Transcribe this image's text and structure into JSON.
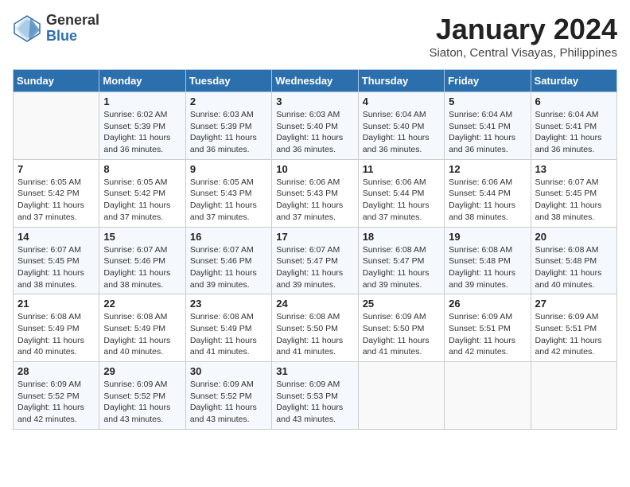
{
  "logo": {
    "general": "General",
    "blue": "Blue"
  },
  "title": "January 2024",
  "location": "Siaton, Central Visayas, Philippines",
  "days_header": [
    "Sunday",
    "Monday",
    "Tuesday",
    "Wednesday",
    "Thursday",
    "Friday",
    "Saturday"
  ],
  "weeks": [
    [
      {
        "day": "",
        "info": ""
      },
      {
        "day": "1",
        "info": "Sunrise: 6:02 AM\nSunset: 5:39 PM\nDaylight: 11 hours\nand 36 minutes."
      },
      {
        "day": "2",
        "info": "Sunrise: 6:03 AM\nSunset: 5:39 PM\nDaylight: 11 hours\nand 36 minutes."
      },
      {
        "day": "3",
        "info": "Sunrise: 6:03 AM\nSunset: 5:40 PM\nDaylight: 11 hours\nand 36 minutes."
      },
      {
        "day": "4",
        "info": "Sunrise: 6:04 AM\nSunset: 5:40 PM\nDaylight: 11 hours\nand 36 minutes."
      },
      {
        "day": "5",
        "info": "Sunrise: 6:04 AM\nSunset: 5:41 PM\nDaylight: 11 hours\nand 36 minutes."
      },
      {
        "day": "6",
        "info": "Sunrise: 6:04 AM\nSunset: 5:41 PM\nDaylight: 11 hours\nand 36 minutes."
      }
    ],
    [
      {
        "day": "7",
        "info": "Sunrise: 6:05 AM\nSunset: 5:42 PM\nDaylight: 11 hours\nand 37 minutes."
      },
      {
        "day": "8",
        "info": "Sunrise: 6:05 AM\nSunset: 5:42 PM\nDaylight: 11 hours\nand 37 minutes."
      },
      {
        "day": "9",
        "info": "Sunrise: 6:05 AM\nSunset: 5:43 PM\nDaylight: 11 hours\nand 37 minutes."
      },
      {
        "day": "10",
        "info": "Sunrise: 6:06 AM\nSunset: 5:43 PM\nDaylight: 11 hours\nand 37 minutes."
      },
      {
        "day": "11",
        "info": "Sunrise: 6:06 AM\nSunset: 5:44 PM\nDaylight: 11 hours\nand 37 minutes."
      },
      {
        "day": "12",
        "info": "Sunrise: 6:06 AM\nSunset: 5:44 PM\nDaylight: 11 hours\nand 38 minutes."
      },
      {
        "day": "13",
        "info": "Sunrise: 6:07 AM\nSunset: 5:45 PM\nDaylight: 11 hours\nand 38 minutes."
      }
    ],
    [
      {
        "day": "14",
        "info": "Sunrise: 6:07 AM\nSunset: 5:45 PM\nDaylight: 11 hours\nand 38 minutes."
      },
      {
        "day": "15",
        "info": "Sunrise: 6:07 AM\nSunset: 5:46 PM\nDaylight: 11 hours\nand 38 minutes."
      },
      {
        "day": "16",
        "info": "Sunrise: 6:07 AM\nSunset: 5:46 PM\nDaylight: 11 hours\nand 39 minutes."
      },
      {
        "day": "17",
        "info": "Sunrise: 6:07 AM\nSunset: 5:47 PM\nDaylight: 11 hours\nand 39 minutes."
      },
      {
        "day": "18",
        "info": "Sunrise: 6:08 AM\nSunset: 5:47 PM\nDaylight: 11 hours\nand 39 minutes."
      },
      {
        "day": "19",
        "info": "Sunrise: 6:08 AM\nSunset: 5:48 PM\nDaylight: 11 hours\nand 39 minutes."
      },
      {
        "day": "20",
        "info": "Sunrise: 6:08 AM\nSunset: 5:48 PM\nDaylight: 11 hours\nand 40 minutes."
      }
    ],
    [
      {
        "day": "21",
        "info": "Sunrise: 6:08 AM\nSunset: 5:49 PM\nDaylight: 11 hours\nand 40 minutes."
      },
      {
        "day": "22",
        "info": "Sunrise: 6:08 AM\nSunset: 5:49 PM\nDaylight: 11 hours\nand 40 minutes."
      },
      {
        "day": "23",
        "info": "Sunrise: 6:08 AM\nSunset: 5:49 PM\nDaylight: 11 hours\nand 41 minutes."
      },
      {
        "day": "24",
        "info": "Sunrise: 6:08 AM\nSunset: 5:50 PM\nDaylight: 11 hours\nand 41 minutes."
      },
      {
        "day": "25",
        "info": "Sunrise: 6:09 AM\nSunset: 5:50 PM\nDaylight: 11 hours\nand 41 minutes."
      },
      {
        "day": "26",
        "info": "Sunrise: 6:09 AM\nSunset: 5:51 PM\nDaylight: 11 hours\nand 42 minutes."
      },
      {
        "day": "27",
        "info": "Sunrise: 6:09 AM\nSunset: 5:51 PM\nDaylight: 11 hours\nand 42 minutes."
      }
    ],
    [
      {
        "day": "28",
        "info": "Sunrise: 6:09 AM\nSunset: 5:52 PM\nDaylight: 11 hours\nand 42 minutes."
      },
      {
        "day": "29",
        "info": "Sunrise: 6:09 AM\nSunset: 5:52 PM\nDaylight: 11 hours\nand 43 minutes."
      },
      {
        "day": "30",
        "info": "Sunrise: 6:09 AM\nSunset: 5:52 PM\nDaylight: 11 hours\nand 43 minutes."
      },
      {
        "day": "31",
        "info": "Sunrise: 6:09 AM\nSunset: 5:53 PM\nDaylight: 11 hours\nand 43 minutes."
      },
      {
        "day": "",
        "info": ""
      },
      {
        "day": "",
        "info": ""
      },
      {
        "day": "",
        "info": ""
      }
    ]
  ]
}
